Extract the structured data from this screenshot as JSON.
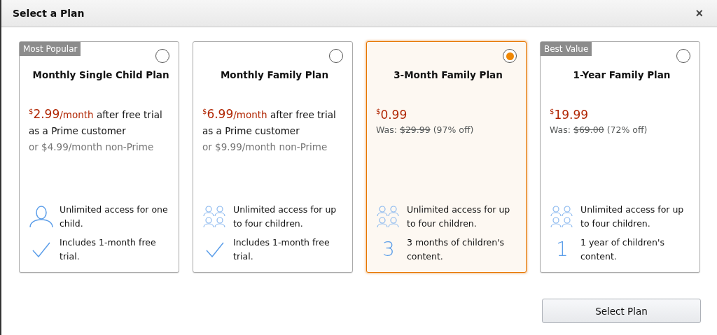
{
  "dialog": {
    "title": "Select a Plan",
    "close": "×"
  },
  "plans": [
    {
      "badge": "Most Popular",
      "title": "Monthly Single Child Plan",
      "selected": false,
      "price": {
        "kind": "prime",
        "currency": "$",
        "amount": "2.99",
        "period": "/month",
        "note": " after free trial as a Prime customer",
        "alternative": "or $4.99/month non-Prime"
      },
      "features": [
        {
          "kind": "person",
          "text": "Unlimited access for one child."
        },
        {
          "kind": "check",
          "text": "Includes 1-month free trial."
        }
      ]
    },
    {
      "title": "Monthly Family Plan",
      "selected": false,
      "price": {
        "kind": "prime",
        "currency": "$",
        "amount": "6.99",
        "period": "/month",
        "note": " after free trial as a Prime customer",
        "alternative": "or $9.99/month non-Prime"
      },
      "features": [
        {
          "kind": "group",
          "text": "Unlimited access for up to four children."
        },
        {
          "kind": "check",
          "text": "Includes 1-month free trial."
        }
      ]
    },
    {
      "title": "3-Month Family Plan",
      "selected": true,
      "price": {
        "kind": "deal",
        "currency": "$",
        "amount": "0.99",
        "was_label": "Was:",
        "was": "$29.99",
        "discount": "(97% off)"
      },
      "features": [
        {
          "kind": "group",
          "text": "Unlimited access for up to four children."
        },
        {
          "kind": "number",
          "number": "3",
          "text": "3 months of children's content."
        }
      ]
    },
    {
      "badge": "Best Value",
      "title": "1-Year Family Plan",
      "selected": false,
      "price": {
        "kind": "deal",
        "currency": "$",
        "amount": "19.99",
        "was_label": "Was:",
        "was": "$69.00",
        "discount": "(72% off)"
      },
      "features": [
        {
          "kind": "group",
          "text": "Unlimited access for up to four children."
        },
        {
          "kind": "number",
          "number": "1",
          "text": "1 year of children's content."
        }
      ]
    }
  ],
  "button": "Select Plan"
}
